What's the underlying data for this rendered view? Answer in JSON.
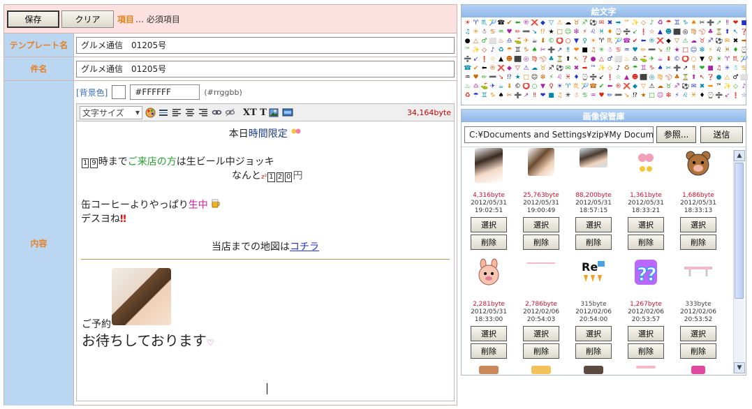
{
  "toolbar": {
    "save_label": "保存",
    "clear_label": "クリア",
    "required_keyword": "項目",
    "required_rest": "… 必須項目"
  },
  "form": {
    "template_label": "テンプレート名",
    "template_value": "グルメ通信　01205号",
    "subject_label": "件名",
    "subject_value": "グルメ通信　01205号",
    "content_label": "内容"
  },
  "bg": {
    "label": "[背景色]",
    "value": "#FFFFFF",
    "hint": "(#rrggbb)"
  },
  "editor": {
    "font_size_label": "文字サイズ",
    "xt_label": "XT T",
    "byte_count": "34,164byte"
  },
  "message": {
    "line1_a": "本日",
    "line1_b": "時間限定",
    "line2_n1": "1",
    "line2_n2": "9",
    "line2_a": "時まで",
    "line2_b": "ご来店の方",
    "line2_c": "は生ビール中ジョッキ",
    "line3_a": "なんと",
    "line3_n1": "1",
    "line3_n2": "2",
    "line3_n3": "0",
    "line3_b": "円",
    "line4_a": "缶コーヒーよりやっぱり",
    "line4_b": "生中",
    "line5": "デスヨね",
    "line6_a": "当店までの地図は",
    "line6_link": "コチラ",
    "line7": "ご予約",
    "line8": "お待ちしております"
  },
  "emoji_panel": {
    "title": "絵文字"
  },
  "image_panel": {
    "title": "画像保管庫",
    "file_path": "C:¥Documents and Settings¥zip¥My Documents",
    "browse_label": "参照...",
    "send_label": "送信",
    "select_label": "選択",
    "delete_label": "削除",
    "images": [
      {
        "size": "4,316byte",
        "date": "2012/05/31",
        "time": "19:02:51"
      },
      {
        "size": "25,763byte",
        "date": "2012/05/31",
        "time": "19:00:49"
      },
      {
        "size": "88,200byte",
        "date": "2012/05/31",
        "time": "18:57:15"
      },
      {
        "size": "1,361byte",
        "date": "2012/05/31",
        "time": "18:33:21"
      },
      {
        "size": "1,686byte",
        "date": "2012/05/31",
        "time": "18:33:13"
      },
      {
        "size": "2,281byte",
        "date": "2012/05/31",
        "time": "18:33:00"
      },
      {
        "size": "2,786byte",
        "date": "2012/02/06",
        "time": "20:54:03"
      },
      {
        "size": "315byte",
        "date": "2012/02/06",
        "time": "20:54:00"
      },
      {
        "size": "1,267byte",
        "date": "2012/02/06",
        "time": "20:53:57"
      },
      {
        "size": "333byte",
        "date": "2012/02/06",
        "time": "20:53:52"
      }
    ]
  }
}
